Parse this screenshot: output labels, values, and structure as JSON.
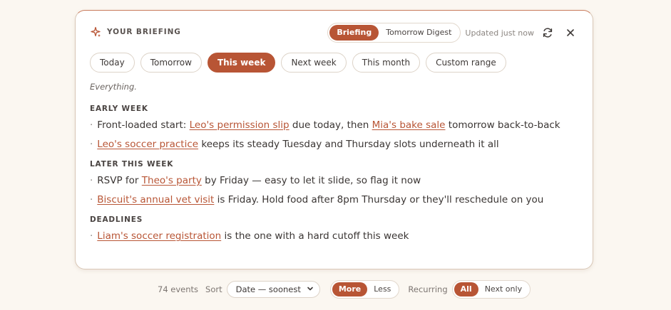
{
  "header": {
    "title": "YOUR BRIEFING",
    "icon": "sparkle-icon",
    "modes": [
      {
        "label": "Briefing",
        "active": true
      },
      {
        "label": "Tomorrow Digest",
        "active": false
      }
    ],
    "updated": "Updated just now",
    "refresh_icon": "refresh-icon",
    "close_icon": "close-icon"
  },
  "tabs": [
    {
      "label": "Today",
      "active": false
    },
    {
      "label": "Tomorrow",
      "active": false
    },
    {
      "label": "This week",
      "active": true
    },
    {
      "label": "Next week",
      "active": false
    },
    {
      "label": "This month",
      "active": false
    },
    {
      "label": "Custom range",
      "active": false
    }
  ],
  "subtitle": "Everything.",
  "sections": [
    {
      "title": "EARLY WEEK",
      "bullets": [
        [
          {
            "text": "Front-loaded start: "
          },
          {
            "text": "Leo's permission slip",
            "link": true
          },
          {
            "text": " due today, then "
          },
          {
            "text": "Mia's bake sale",
            "link": true
          },
          {
            "text": " tomorrow back-to-back"
          }
        ],
        [
          {
            "text": "Leo's soccer practice",
            "link": true
          },
          {
            "text": " keeps its steady Tuesday and Thursday slots underneath it all"
          }
        ]
      ]
    },
    {
      "title": "LATER THIS WEEK",
      "bullets": [
        [
          {
            "text": "RSVP for "
          },
          {
            "text": "Theo's party",
            "link": true
          },
          {
            "text": " by Friday — easy to let it slide, so flag it now"
          }
        ],
        [
          {
            "text": "Biscuit's annual vet visit",
            "link": true
          },
          {
            "text": " is Friday. Hold food after 8pm Thursday or they'll reschedule on you"
          }
        ]
      ]
    },
    {
      "title": "DEADLINES",
      "bullets": [
        [
          {
            "text": "Liam's soccer registration",
            "link": true
          },
          {
            "text": " is the one with a hard cutoff this week"
          }
        ]
      ]
    }
  ],
  "footer": {
    "events": "74 events",
    "sort_label": "Sort",
    "sort_value": "Date — soonest",
    "density": [
      {
        "label": "More",
        "active": true
      },
      {
        "label": "Less",
        "active": false
      }
    ],
    "recurring_label": "Recurring",
    "recurring": [
      {
        "label": "All",
        "active": true
      },
      {
        "label": "Next only",
        "active": false
      }
    ]
  },
  "colors": {
    "accent": "#b85535",
    "background": "#fbf7f1",
    "text": "#3a3533"
  }
}
